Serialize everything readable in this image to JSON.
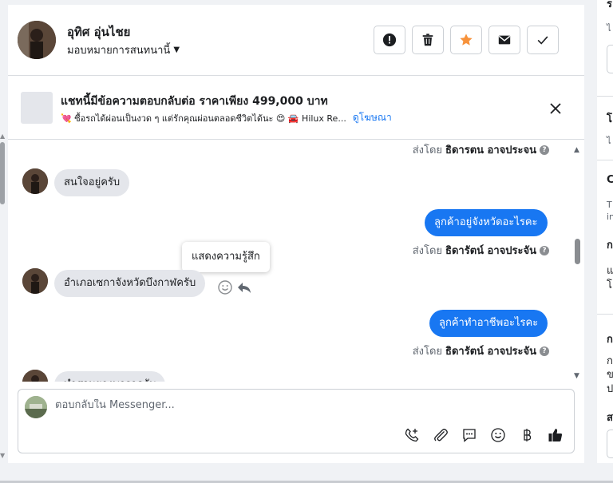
{
  "header": {
    "contact_name": "อุทิศ อุ่นไชย",
    "assign_label": "มอบหมายการสนทนานี้",
    "buttons": [
      "report-icon",
      "trash-icon",
      "star-icon",
      "mail-icon",
      "check-icon"
    ]
  },
  "ad": {
    "title": "แชทนี้มีข้อความตอบกลับต่อ ราคาเพียง 499,000 บาท",
    "subtitle": "💘 ซื้อรถได้ผ่อนเป็นงวด ๆ แต่รักคุณผ่อนตลอดชีวิตได้นะ 😍 🚘 Hilux Re...",
    "link": "ดูโฆษณา"
  },
  "thread": {
    "sent_by_prefix": "ส่งโดย",
    "sender_name": "ธิดารัตน์ อาจประจัน",
    "top_sent_by": "ธิดารตน อาจประจน",
    "messages": [
      {
        "dir": "in",
        "text": "สนใจอยู่ครับ"
      },
      {
        "dir": "out",
        "text": "ลูกค้าอยู่จังหวัดอะไรคะ"
      },
      {
        "dir": "in",
        "text": "อำเภอเซกาจังหวัดบึงกาฬครับ"
      },
      {
        "dir": "out",
        "text": "ลูกค้าทำอาชีพอะไรคะ"
      },
      {
        "dir": "in",
        "text": "ทำสวนยางพาราครับ"
      }
    ],
    "tooltip": "แสดงความรู้สึก"
  },
  "composer": {
    "placeholder": "ตอบกลับใน Messenger...",
    "tools": [
      "call-add-icon",
      "attachment-icon",
      "saved-reply-icon",
      "emoji-icon",
      "baht-icon",
      "like-icon"
    ]
  },
  "right_panel": {
    "headings": [
      "ร",
      "ไ",
      "โ",
      "ไ",
      "C",
      "T",
      "in",
      "ก",
      "แ",
      "โ",
      "ก",
      "ก",
      "ข",
      "ป",
      "ส"
    ]
  },
  "colors": {
    "accent": "#1877f2",
    "star": "#f7923b",
    "bubble_in": "#e4e6eb"
  }
}
